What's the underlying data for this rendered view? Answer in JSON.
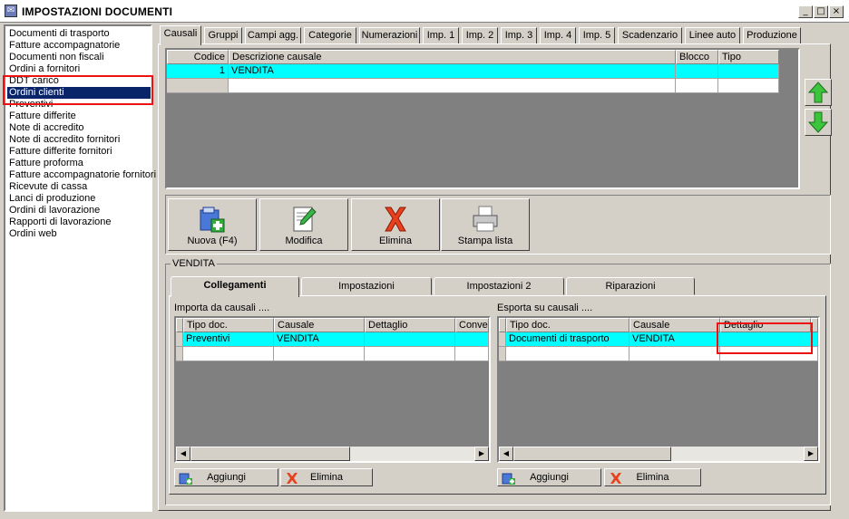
{
  "window": {
    "title": "IMPOSTAZIONI DOCUMENTI",
    "min_glyph": "_",
    "max_glyph": "□",
    "close_glyph": "×"
  },
  "doc_types": [
    "Documenti di trasporto",
    "Fatture accompagnatorie",
    "Documenti non fiscali",
    "Ordini a fornitori",
    "DDT carico",
    "Ordini clienti",
    "Preventivi",
    "Fatture differite",
    "Note di accredito",
    "Note di accredito fornitori",
    "Fatture differite fornitori",
    "Fatture proforma",
    "Fatture accompagnatorie fornitori",
    "Ricevute di cassa",
    "Lanci di produzione",
    "Ordini di lavorazione",
    "Rapporti di lavorazione",
    "Ordini web"
  ],
  "selected_doc_type": "Ordini clienti",
  "tabs": [
    "Causali",
    "Gruppi",
    "Campi agg.",
    "Categorie",
    "Numerazioni",
    "Imp. 1",
    "Imp. 2",
    "Imp. 3",
    "Imp. 4",
    "Imp. 5",
    "Scadenzario",
    "Linee auto",
    "Produzione"
  ],
  "active_tab": "Causali",
  "causali_grid": {
    "columns": [
      "Codice",
      "Descrizione causale",
      "Blocco",
      "Tipo"
    ],
    "rows": [
      {
        "codice": "1",
        "descrizione": "VENDITA",
        "blocco": "",
        "tipo": ""
      }
    ]
  },
  "toolbar": {
    "nuova": "Nuova (F4)",
    "modifica": "Modifica",
    "elimina": "Elimina",
    "stampa": "Stampa lista"
  },
  "group_title": "VENDITA",
  "subtabs": [
    "Collegamenti",
    "Impostazioni",
    "Impostazioni 2",
    "Riparazioni"
  ],
  "active_subtab": "Collegamenti",
  "importa": {
    "label": "Importa da causali ....",
    "columns": [
      "Tipo doc.",
      "Causale",
      "Dettaglio",
      "Conver"
    ],
    "rows": [
      {
        "tipo": "Preventivi",
        "causale": "VENDITA",
        "dettaglio": "",
        "conv": ""
      }
    ],
    "add": "Aggiungi",
    "delete": "Elimina"
  },
  "esporta": {
    "label": "Esporta su causali ....",
    "columns": [
      "Tipo doc.",
      "Causale",
      "Dettaglio"
    ],
    "rows": [
      {
        "tipo": "Documenti di trasporto",
        "causale": "VENDITA",
        "dettaglio": ""
      }
    ],
    "add": "Aggiungi",
    "delete": "Elimina"
  },
  "colors": {
    "selection": "#0a246a",
    "row_highlight": "#00ffff",
    "annotation": "#e11111",
    "arrow_green": "#2fa82f"
  },
  "icons": {
    "up": "arrow-up-icon",
    "down": "arrow-down-icon",
    "nuova": "new-document-icon",
    "modifica": "edit-document-icon",
    "elimina": "red-x-icon",
    "stampa": "printer-icon"
  }
}
